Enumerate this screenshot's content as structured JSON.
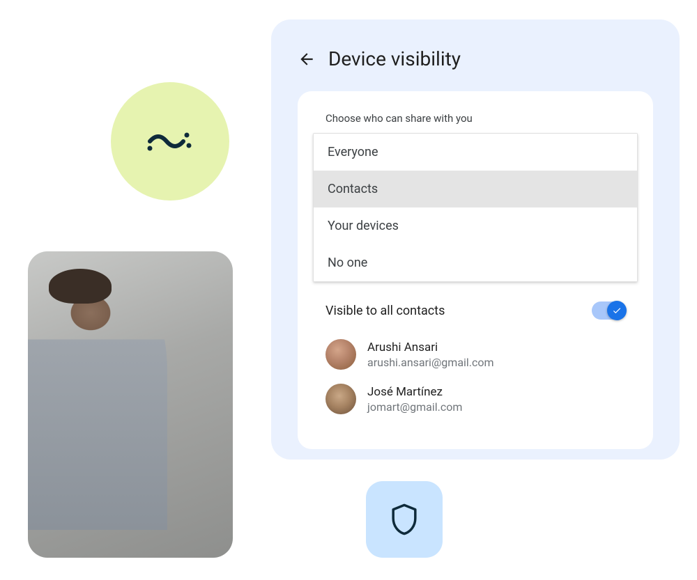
{
  "panel": {
    "title": "Device visibility",
    "choose_label": "Choose who can share with you",
    "options": [
      {
        "label": "Everyone",
        "selected": false
      },
      {
        "label": "Contacts",
        "selected": true
      },
      {
        "label": "Your devices",
        "selected": false
      },
      {
        "label": "No one",
        "selected": false
      }
    ],
    "visibility_toggle": {
      "label": "Visible to all contacts",
      "enabled": true
    },
    "contacts": [
      {
        "name": "Arushi Ansari",
        "email": "arushi.ansari@gmail.com"
      },
      {
        "name": "José Martínez",
        "email": "jomart@gmail.com"
      }
    ]
  },
  "icons": {
    "decorative": "wave-icon",
    "shield": "shield-icon",
    "back": "arrow-left-icon",
    "check": "check-icon"
  },
  "colors": {
    "panel_bg": "#eaf1fe",
    "accent": "#1a73e8",
    "circle_bg": "#e6f3b0",
    "shield_tile": "#c9e4ff"
  }
}
